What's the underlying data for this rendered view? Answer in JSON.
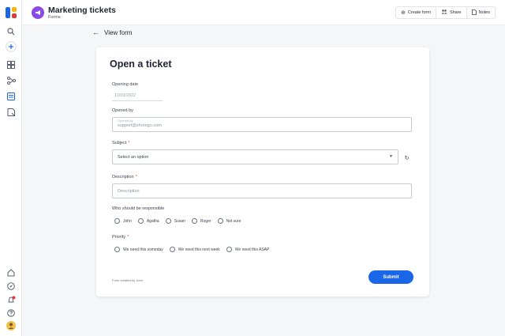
{
  "header": {
    "title": "Marketing tickets",
    "subtitle": "Forms",
    "buttons": [
      {
        "label": "Create form",
        "icon": "plus-circle-icon"
      },
      {
        "label": "Share",
        "icon": "people-icon"
      },
      {
        "label": "Notes",
        "icon": "notes-icon"
      }
    ]
  },
  "back_link": "View form",
  "form": {
    "title": "Open a ticket",
    "opening_date_label": "Opening date",
    "opening_date_value": "11/03/2022",
    "opened_by_label": "Opened by",
    "opened_by_float_label": "Opened by",
    "opened_by_value": "support@shorego.com",
    "subject_label": "Subject",
    "subject_placeholder": "Select an option",
    "description_label": "Description",
    "description_placeholder": "Description",
    "responsible_label": "Who should be responsible",
    "responsible_options": [
      "John",
      "Agatha",
      "Susan",
      "Roger",
      "Not sure"
    ],
    "priority_label": "Priority",
    "priority_options": [
      "We need this someday",
      "We need this next week",
      "We need this ASAP"
    ],
    "footer_note": "Form created by John",
    "submit_label": "Submit",
    "required_marker": "*"
  },
  "colors": {
    "accent": "#1a66e8",
    "app_badge": "#8a4ae8",
    "required": "#e53935",
    "notification_dot": "#e53935"
  }
}
